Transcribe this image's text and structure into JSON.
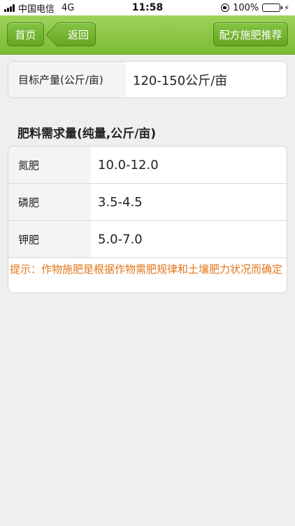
{
  "status_bar": {
    "carrier": "中国电信",
    "network": "4G",
    "time": "11:58",
    "battery": "100%"
  },
  "nav": {
    "home_label": "首页",
    "back_label": "返回",
    "recommend_label": "配方施肥推荐"
  },
  "target": {
    "label": "目标产量(公斤/亩)",
    "value": "120-150公斤/亩"
  },
  "section_title": "肥料需求量(纯量,公斤/亩)",
  "fertilizers": [
    {
      "name": "氮肥",
      "amount": "10.0-12.0"
    },
    {
      "name": "磷肥",
      "amount": "3.5-4.5"
    },
    {
      "name": "钾肥",
      "amount": "5.0-7.0"
    }
  ],
  "tip": "提示：作物施肥是根据作物需肥规律和土壤肥力状况而确定",
  "colors": {
    "nav_green": "#7dbb34",
    "tip_orange": "#e2761b",
    "battery_green": "#3fc23f"
  }
}
